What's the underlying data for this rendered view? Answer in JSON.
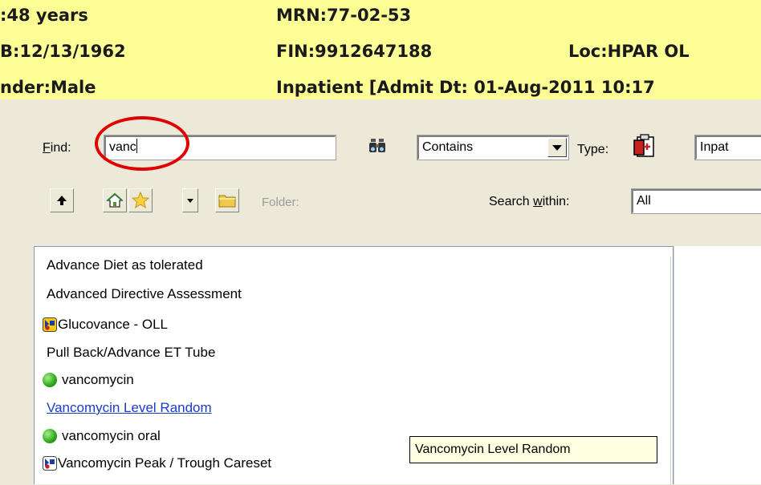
{
  "patient_banner": {
    "age": ":48 years",
    "dob": "B:12/13/1962",
    "gender": "nder:Male",
    "mrn": "MRN:77-02-53",
    "fin": "FIN:9912647188",
    "location": "Loc:HPAR OL",
    "encounter": "Inpatient [Admit Dt: 01-Aug-2011 10:17"
  },
  "find_bar": {
    "find_label_first": "F",
    "find_label_rest": "ind:",
    "find_value": "vanc",
    "match_mode": "Contains",
    "type_label": "Type:",
    "type_value": "Inpat"
  },
  "toolbar": {
    "folder_label": "Folder:",
    "search_within_label_a": "Search ",
    "search_within_label_u": "w",
    "search_within_label_b": "ithin:",
    "search_within_value": "All"
  },
  "results": [
    {
      "label": "Advance Diet as tolerated",
      "icon": "none"
    },
    {
      "label": "Advanced Directive Assessment",
      "icon": "none"
    },
    {
      "label": "Glucovance - OLL",
      "icon": "careset-icon"
    },
    {
      "label": "Pull Back/Advance ET Tube",
      "icon": "none"
    },
    {
      "label": "vancomycin",
      "icon": "medication-icon"
    },
    {
      "label": "Vancomycin Level Random",
      "icon": "none",
      "hovered": true
    },
    {
      "label": "vancomycin oral",
      "icon": "medication-icon"
    },
    {
      "label": "Vancomycin Peak / Trough Careset",
      "icon": "careset-icon"
    }
  ],
  "tooltip": "Vancomycin Level Random",
  "colors": {
    "banner": "#fdfd96",
    "highlight_ring": "#e00000",
    "link": "#1a3cc8",
    "tooltip_bg": "#ffffe1"
  }
}
